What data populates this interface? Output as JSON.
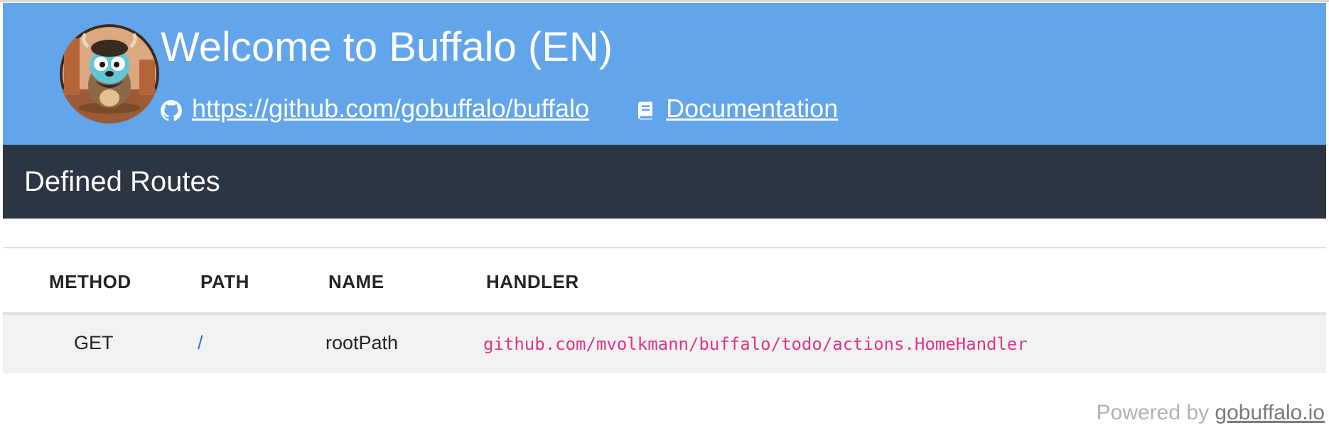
{
  "header": {
    "title": "Welcome to Buffalo (EN)",
    "github_link": "https://github.com/gobuffalo/buffalo",
    "docs_link": "Documentation",
    "background": "#62a5ea"
  },
  "routes": {
    "title": "Defined Routes",
    "columns": [
      "METHOD",
      "PATH",
      "NAME",
      "HANDLER"
    ],
    "rows": [
      {
        "method": "GET",
        "path": "/",
        "name": "rootPath",
        "handler": "github.com/mvolkmann/buffalo/todo/actions.HomeHandler"
      }
    ]
  },
  "footer": {
    "prefix": "Powered by",
    "link": "gobuffalo.io"
  },
  "icons": {
    "logo": "buffalo-gopher-logo",
    "github": "github-icon",
    "docs": "book-icon"
  },
  "colors": {
    "header_bg": "#62a5ea",
    "routes_bar_bg": "#2b3642",
    "handler_text": "#e0358a",
    "path_link": "#1b7ad6"
  }
}
